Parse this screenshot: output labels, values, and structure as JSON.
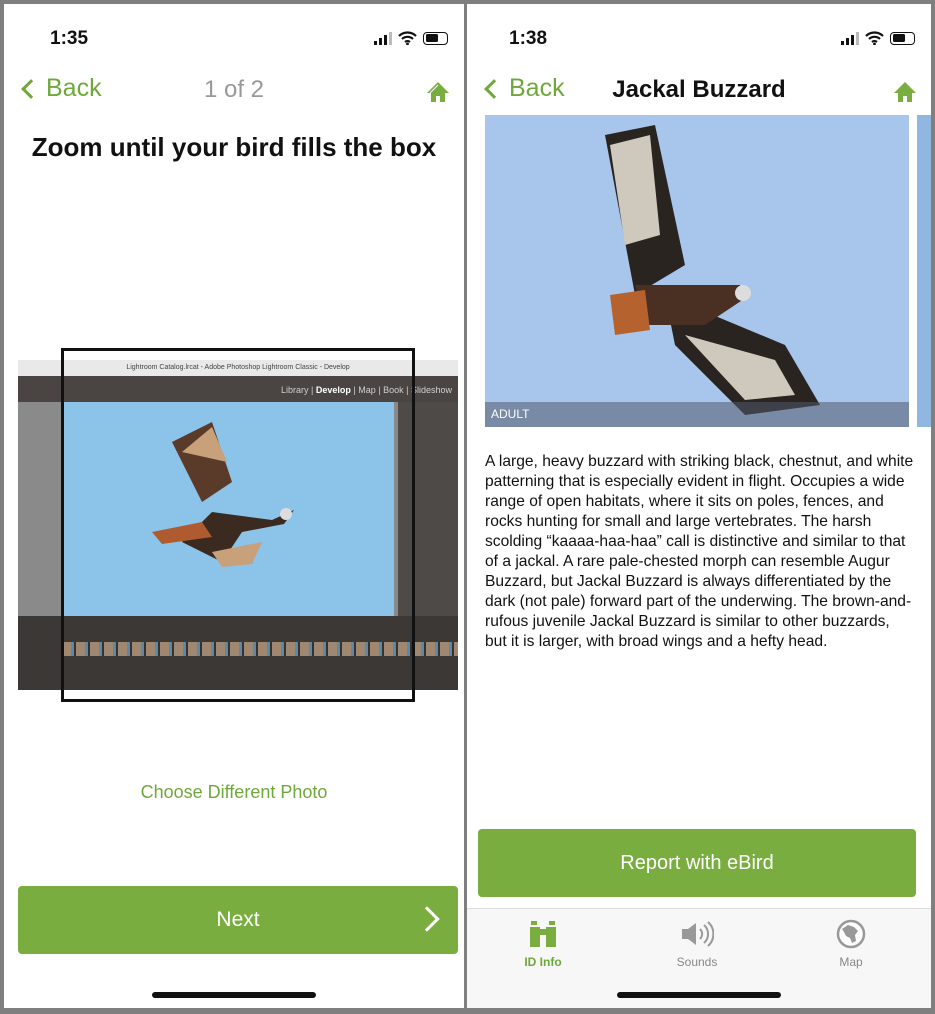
{
  "left": {
    "status": {
      "time": "1:35"
    },
    "nav": {
      "back": "Back",
      "title": "1 of 2"
    },
    "heading": "Zoom until your bird fills the box",
    "photo": {
      "window_title": "Lightroom Catalog.lrcat - Adobe Photoshop Lightroom Classic - Develop",
      "modules": [
        "Library",
        "Develop",
        "Map",
        "Book",
        "Slideshow"
      ]
    },
    "choose_photo": "Choose Different Photo",
    "next": "Next"
  },
  "right": {
    "status": {
      "time": "1:38"
    },
    "nav": {
      "back": "Back",
      "title": "Jackal Buzzard"
    },
    "image_caption": "ADULT",
    "description": "A large, heavy buzzard with striking black, chestnut, and white patterning that is especially evident in flight. Occupies a wide range of open habitats, where it sits on poles, fences, and rocks hunting for small and large vertebrates. The harsh scolding “kaaaa-haa-haa” call is distinctive and similar to that of a jackal. A rare pale-chested morph can resemble Augur Buzzard, but Jackal Buzzard is always differentiated by the dark (not pale) forward part of the underwing. The brown-and-rufous juvenile Jackal Buzzard is similar to other buzzards, but it is larger, with broad wings and a hefty head.",
    "report": "Report with eBird",
    "tabs": [
      {
        "label": "ID Info",
        "icon": "binoculars-icon",
        "active": true
      },
      {
        "label": "Sounds",
        "icon": "speaker-icon"
      },
      {
        "label": "Map",
        "icon": "globe-icon"
      }
    ]
  },
  "colors": {
    "accent": "#7aad3f",
    "accent_text": "#6fa83a"
  }
}
